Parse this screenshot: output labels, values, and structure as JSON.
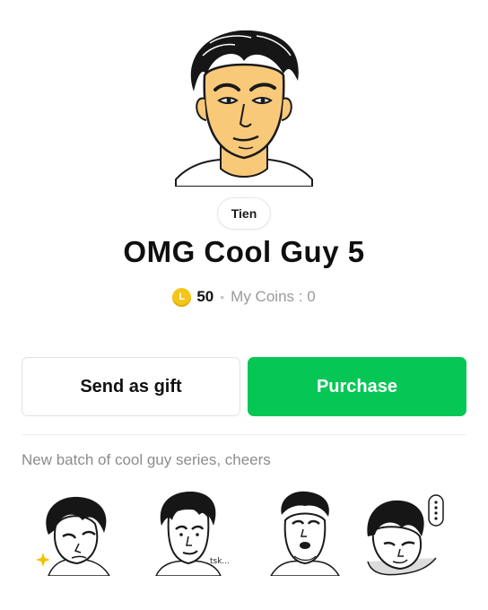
{
  "author": "Tien",
  "title": "OMG Cool Guy 5",
  "price": {
    "coin_letter": "L",
    "amount": "50",
    "my_coins": "My Coins : 0"
  },
  "actions": {
    "gift_label": "Send as gift",
    "purchase_label": "Purchase"
  },
  "description": "New batch of cool guy series, cheers",
  "stickers": [
    {
      "name": "sticker-sparkle-tilt",
      "caption": ""
    },
    {
      "name": "sticker-tsk",
      "caption": "tsk..."
    },
    {
      "name": "sticker-look-up",
      "caption": ""
    },
    {
      "name": "sticker-thinking",
      "caption": ""
    }
  ],
  "colors": {
    "purchase_green": "#06c755",
    "coin_yellow": "#f5c518",
    "skin_main": "#f9c97a",
    "text_muted": "#8c8c8c"
  }
}
